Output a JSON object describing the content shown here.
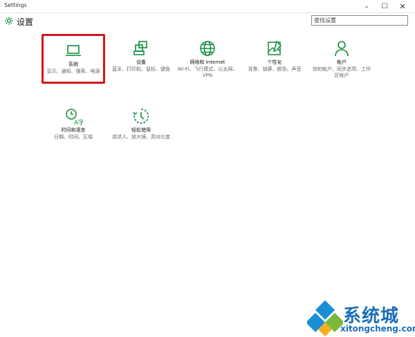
{
  "window": {
    "title": "Settings",
    "minimize_glyph": "–",
    "maximize_glyph": "☐",
    "close_glyph": "✕"
  },
  "header": {
    "title": "设置",
    "search_placeholder": "查找设置"
  },
  "accent_color": "#0f8c3c",
  "selection_color": "#d3151d",
  "tiles": [
    {
      "label": "系统",
      "desc": "显示、通知、搜索、电源",
      "icon": "laptop-icon",
      "selected": true
    },
    {
      "label": "设备",
      "desc": "蓝牙、打印机、鼠标、键盘",
      "icon": "devices-icon",
      "selected": false
    },
    {
      "label": "网络和 Internet",
      "desc": "Wi-Fi、飞行模式、以太网、VPN",
      "icon": "globe-icon",
      "selected": false
    },
    {
      "label": "个性化",
      "desc": "背景、锁屏、颜色、声音",
      "icon": "personalization-icon",
      "selected": false
    },
    {
      "label": "帐户",
      "desc": "你的帐户、同步选项、工作区帐户",
      "icon": "person-icon",
      "selected": false
    },
    {
      "label": "时间和语言",
      "desc": "日期、时间、区域",
      "icon": "time-language-icon",
      "selected": false
    },
    {
      "label": "轻松使用",
      "desc": "讲述人、放大镜、高对比度",
      "icon": "ease-of-access-icon",
      "selected": false
    }
  ],
  "watermark": {
    "text": "系统城",
    "url": "xitongcheng.com"
  }
}
